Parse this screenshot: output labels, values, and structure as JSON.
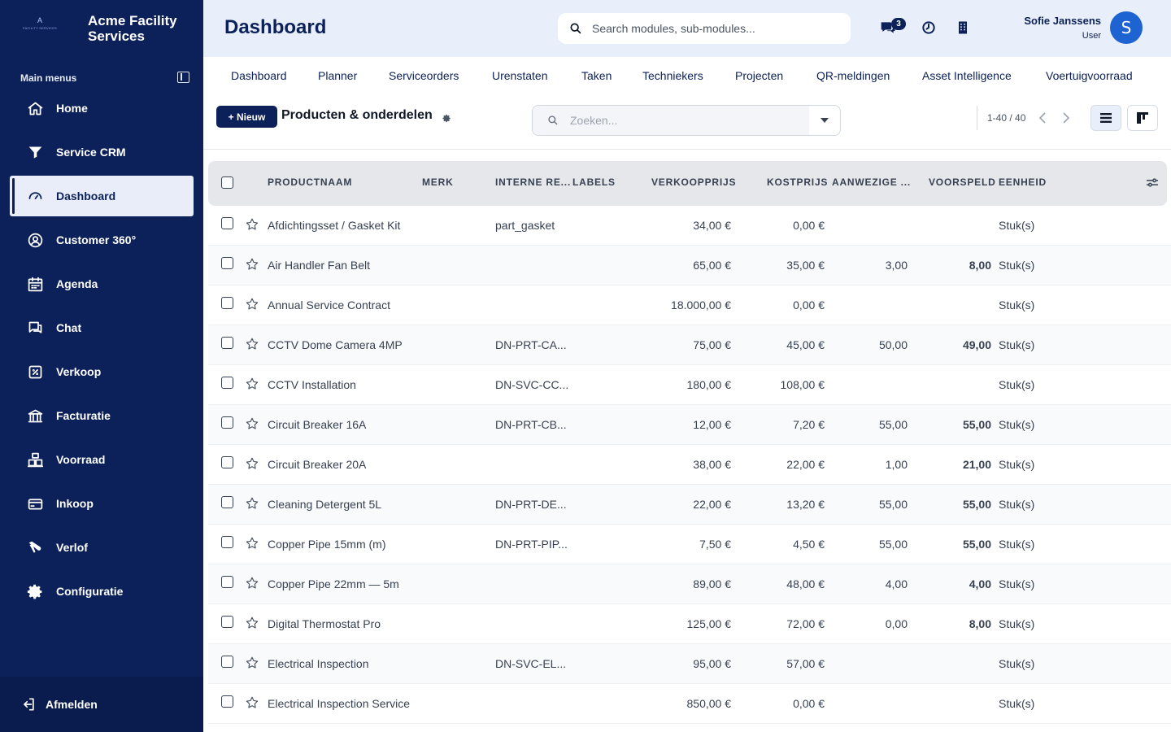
{
  "brand": {
    "logo_letter": "A",
    "logo_sub": "FACILITY SERVICES",
    "name": "Acme Facility Services"
  },
  "sidebar": {
    "heading": "Main menus",
    "items": [
      {
        "label": "Home",
        "icon": "home-icon"
      },
      {
        "label": "Service CRM",
        "icon": "filter-icon"
      },
      {
        "label": "Dashboard",
        "icon": "gauge-icon",
        "active": true
      },
      {
        "label": "Customer 360°",
        "icon": "user-circle-icon"
      },
      {
        "label": "Agenda",
        "icon": "calendar-icon"
      },
      {
        "label": "Chat",
        "icon": "chat-icon"
      },
      {
        "label": "Verkoop",
        "icon": "percent-icon"
      },
      {
        "label": "Facturatie",
        "icon": "bank-icon"
      },
      {
        "label": "Voorraad",
        "icon": "warehouse-icon"
      },
      {
        "label": "Inkoop",
        "icon": "card-icon"
      },
      {
        "label": "Verlof",
        "icon": "plane-icon"
      },
      {
        "label": "Configuratie",
        "icon": "gear-icon"
      }
    ],
    "logout": "Afmelden"
  },
  "header": {
    "title": "Dashboard",
    "search_placeholder": "Search modules, sub-modules...",
    "chat_count": "3",
    "user_name": "Sofie Janssens",
    "user_role": "User",
    "avatar_initial": "S"
  },
  "tabs": [
    "Dashboard",
    "Planner",
    "Serviceorders",
    "Urenstaten",
    "Taken",
    "Technieker­s",
    "Projecten",
    "QR-meldingen",
    "Asset Intelligence",
    "Voertuigvoorraad"
  ],
  "toolbar": {
    "new_label": "+ Nieuw",
    "section_title": "Producten & onderdelen",
    "search_placeholder": "Zoeken...",
    "pager": "1-40 / 40"
  },
  "table": {
    "columns": [
      "PRODUCTNAAM",
      "MERK",
      "INTERNE RE...",
      "LABELS",
      "VERKOOPPRIJS",
      "KOSTPRIJS",
      "AANWEZIGE ...",
      "VOORSPELD",
      "EENHEID"
    ],
    "rows": [
      {
        "name": "Afdichtingsset / Gasket Kit",
        "ref": "part_gasket",
        "price": "34,00 €",
        "cost": "0,00 €",
        "stock": "",
        "forecast": "",
        "unit": "Stuk(s)"
      },
      {
        "name": "Air Handler Fan Belt",
        "ref": "",
        "price": "65,00 €",
        "cost": "35,00 €",
        "stock": "3,00",
        "forecast": "8,00",
        "unit": "Stuk(s)"
      },
      {
        "name": "Annual Service Contract",
        "ref": "",
        "price": "18.000,00 €",
        "cost": "0,00 €",
        "stock": "",
        "forecast": "",
        "unit": "Stuk(s)"
      },
      {
        "name": "CCTV Dome Camera 4MP",
        "ref": "DN-PRT-CA...",
        "price": "75,00 €",
        "cost": "45,00 €",
        "stock": "50,00",
        "forecast": "49,00",
        "unit": "Stuk(s)"
      },
      {
        "name": "CCTV Installation",
        "ref": "DN-SVC-CC...",
        "price": "180,00 €",
        "cost": "108,00 €",
        "stock": "",
        "forecast": "",
        "unit": "Stuk(s)"
      },
      {
        "name": "Circuit Breaker 16A",
        "ref": "DN-PRT-CB...",
        "price": "12,00 €",
        "cost": "7,20 €",
        "stock": "55,00",
        "forecast": "55,00",
        "unit": "Stuk(s)"
      },
      {
        "name": "Circuit Breaker 20A",
        "ref": "",
        "price": "38,00 €",
        "cost": "22,00 €",
        "stock": "1,00",
        "forecast": "21,00",
        "unit": "Stuk(s)"
      },
      {
        "name": "Cleaning Detergent 5L",
        "ref": "DN-PRT-DE...",
        "price": "22,00 €",
        "cost": "13,20 €",
        "stock": "55,00",
        "forecast": "55,00",
        "unit": "Stuk(s)"
      },
      {
        "name": "Copper Pipe 15mm (m)",
        "ref": "DN-PRT-PIP...",
        "price": "7,50 €",
        "cost": "4,50 €",
        "stock": "55,00",
        "forecast": "55,00",
        "unit": "Stuk(s)"
      },
      {
        "name": "Copper Pipe 22mm — 5m",
        "ref": "",
        "price": "89,00 €",
        "cost": "48,00 €",
        "stock": "4,00",
        "forecast": "4,00",
        "unit": "Stuk(s)"
      },
      {
        "name": "Digital Thermostat Pro",
        "ref": "",
        "price": "125,00 €",
        "cost": "72,00 €",
        "stock": "0,00",
        "forecast": "8,00",
        "unit": "Stuk(s)"
      },
      {
        "name": "Electrical Inspection",
        "ref": "DN-SVC-EL...",
        "price": "95,00 €",
        "cost": "57,00 €",
        "stock": "",
        "forecast": "",
        "unit": "Stuk(s)"
      },
      {
        "name": "Electrical Inspection Service",
        "ref": "",
        "price": "850,00 €",
        "cost": "0,00 €",
        "stock": "",
        "forecast": "",
        "unit": "Stuk(s)"
      }
    ]
  },
  "colors": {
    "navy": "#0c2159",
    "accent_blue": "#1d63d2",
    "topbar_bg": "#e8eefa"
  }
}
